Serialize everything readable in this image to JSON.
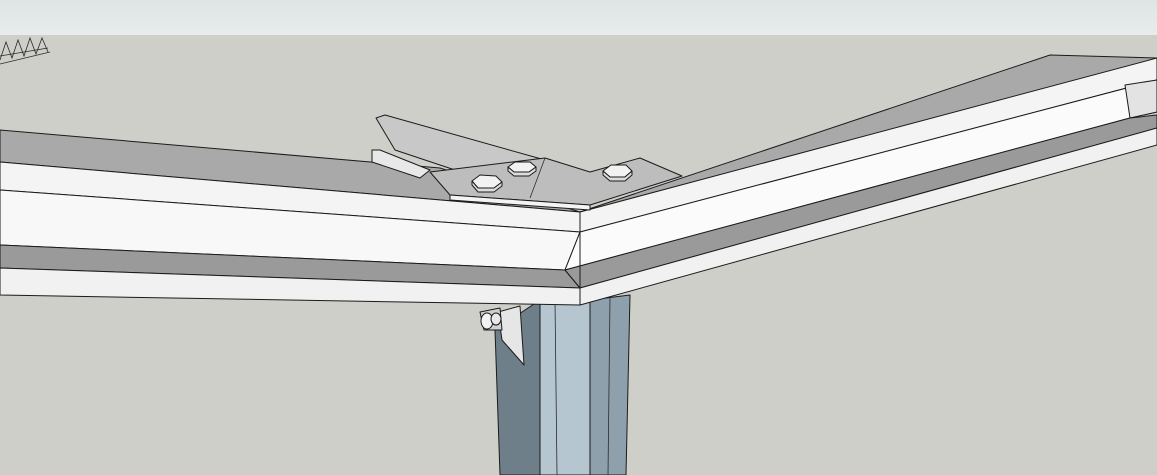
{
  "viewport": {
    "label": "",
    "background_color": "#cfcfca",
    "sky_color": "#e4e8e8"
  },
  "colors": {
    "beam_top": "#a9a9a9",
    "beam_face": "#f4f4f4",
    "beam_shadow": "#8f8f8f",
    "plate": "#b8b8b8",
    "plate_light": "#d9d9d9",
    "column_dark": "#6f7f8a",
    "column_light": "#b6c6d0",
    "column_mid": "#8ea0ab",
    "edge": "#1b1b1b"
  },
  "model": {
    "objects": [
      "steel-i-beam-left",
      "steel-i-beam-right",
      "splice-plate",
      "hex-bolt",
      "steel-column",
      "bracket-angle",
      "truss-fragment"
    ]
  }
}
